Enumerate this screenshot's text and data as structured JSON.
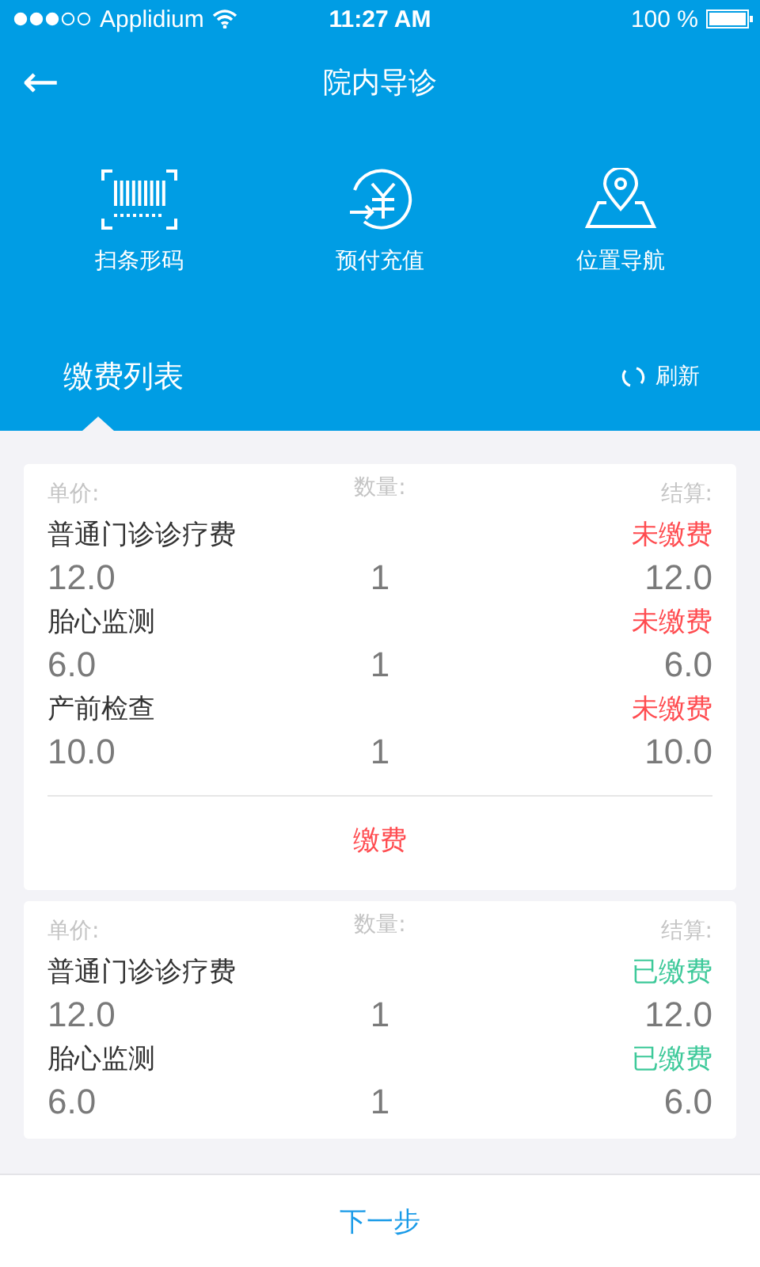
{
  "status_bar": {
    "carrier": "Applidium",
    "time": "11:27 AM",
    "battery": "100 %"
  },
  "nav": {
    "back": "←",
    "title": "院内导诊"
  },
  "actions": [
    {
      "kind": "barcode",
      "label": "扫条形码"
    },
    {
      "kind": "payment",
      "label": "预付充值"
    },
    {
      "kind": "location",
      "label": "位置导航"
    }
  ],
  "section": {
    "title": "缴费列表",
    "refresh": "刷新"
  },
  "cards": [
    {
      "headers": [
        "单价:",
        "数量:",
        "结算:"
      ],
      "items": [
        {
          "name": "普通门诊诊疗费",
          "status": "未缴费",
          "paid": false,
          "price": "12.0",
          "qty": "1",
          "total": "12.0"
        },
        {
          "name": "胎心监测",
          "status": "未缴费",
          "paid": false,
          "price": "6.0",
          "qty": "1",
          "total": "6.0"
        },
        {
          "name": "产前检查",
          "status": "未缴费",
          "paid": false,
          "price": "10.0",
          "qty": "1",
          "total": "10.0"
        }
      ],
      "pay_button": "缴费"
    },
    {
      "headers": [
        "单价:",
        "数量:",
        "结算:"
      ],
      "items": [
        {
          "name": "普通门诊诊疗费",
          "status": "已缴费",
          "paid": true,
          "price": "12.0",
          "qty": "1",
          "total": "12.0"
        },
        {
          "name": "胎心监测",
          "status": "已缴费",
          "paid": true,
          "price": "6.0",
          "qty": "1",
          "total": "6.0"
        }
      ]
    }
  ],
  "footer": {
    "next": "下一步"
  }
}
